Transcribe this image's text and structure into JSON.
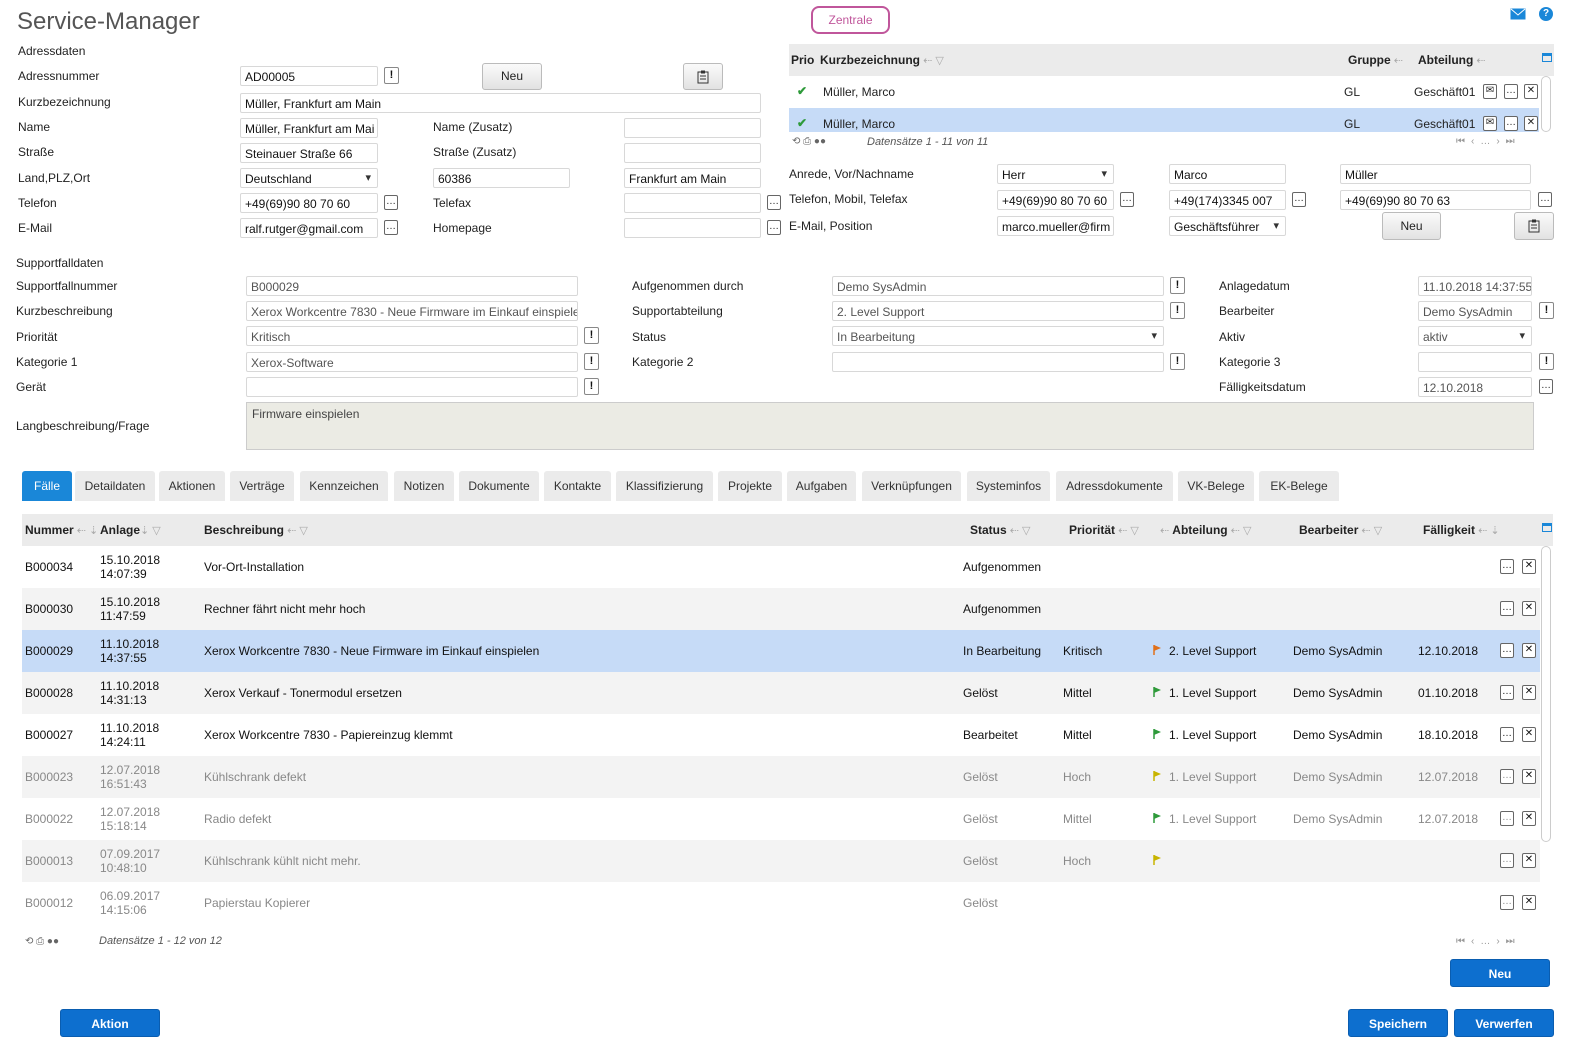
{
  "app": {
    "title": "Service-Manager",
    "zentrale": "Zentrale"
  },
  "adresse": {
    "section": "Adressdaten",
    "labels": {
      "adressnummer": "Adressnummer",
      "kurzbezeichnung": "Kurzbezeichnung",
      "name": "Name",
      "strasse": "Straße",
      "land": "Land,PLZ,Ort",
      "telefon": "Telefon",
      "email": "E-Mail",
      "name_zusatz": "Name (Zusatz)",
      "strasse_zusatz": "Straße (Zusatz)",
      "telefax": "Telefax",
      "homepage": "Homepage"
    },
    "values": {
      "adressnummer": "AD00005",
      "kurzbezeichnung": "Müller, Frankfurt am Main",
      "name": "Müller, Frankfurt am Mai",
      "strasse": "Steinauer Straße 66",
      "land": "Deutschland",
      "plz": "60386",
      "ort": "Frankfurt am Main",
      "telefon": "+49(69)90 80 70 60",
      "email": "ralf.rutger@gmail.com",
      "name_zusatz": "",
      "strasse_zusatz": "",
      "telefax": "",
      "homepage": ""
    },
    "neu_button": "Neu"
  },
  "kontakte": {
    "headers": {
      "prio": "Prio",
      "kurzbezeichnung": "Kurzbezeichnung",
      "gruppe": "Gruppe",
      "abteilung": "Abteilung"
    },
    "rows": [
      {
        "name": "Müller, Marco",
        "gruppe": "GL",
        "abteilung": "Geschäft01"
      },
      {
        "name": "Müller, Marco",
        "gruppe": "GL",
        "abteilung": "Geschäft01"
      }
    ],
    "footer": "Datensätze 1 - 11 von 11",
    "labels": {
      "anrede": "Anrede, Vor/Nachname",
      "telefon": "Telefon, Mobil, Telefax",
      "email": "E-Mail, Position"
    },
    "values": {
      "anrede": "Herr",
      "vorname": "Marco",
      "nachname": "Müller",
      "telefon": "+49(69)90 80 70 60",
      "mobil": "+49(174)3345 007",
      "telefax": "+49(69)90 80 70 63",
      "email": "marco.mueller@firm",
      "position": "Geschäftsführer"
    },
    "neu_button": "Neu"
  },
  "support": {
    "section": "Supportfalldaten",
    "labels": {
      "nummer": "Supportfallnummer",
      "kurz": "Kurzbeschreibung",
      "prio": "Priorität",
      "kat1": "Kategorie 1",
      "geraet": "Gerät",
      "lang": "Langbeschreibung/Frage",
      "aufgenommen": "Aufgenommen durch",
      "abteilung": "Supportabteilung",
      "status": "Status",
      "kat2": "Kategorie 2",
      "anlage": "Anlagedatum",
      "bearbeiter": "Bearbeiter",
      "aktiv": "Aktiv",
      "kat3": "Kategorie 3",
      "faellig": "Fälligkeitsdatum"
    },
    "values": {
      "nummer": "B000029",
      "kurz": "Xerox Workcentre 7830 - Neue Firmware im Einkauf einspiele",
      "prio": "Kritisch",
      "kat1": "Xerox-Software",
      "geraet": "",
      "lang": "Firmware einspielen",
      "aufgenommen": "Demo SysAdmin",
      "abteilung": "2. Level Support",
      "status": "In Bearbeitung",
      "kat2": "",
      "anlage": "11.10.2018 14:37:55",
      "bearbeiter": "Demo SysAdmin",
      "aktiv": "aktiv",
      "kat3": "",
      "faellig": "12.10.2018"
    }
  },
  "tabs": [
    "Fälle",
    "Detaildaten",
    "Aktionen",
    "Verträge",
    "Kennzeichen",
    "Notizen",
    "Dokumente",
    "Kontakte",
    "Klassifizierung",
    "Projekte",
    "Aufgaben",
    "Verknüpfungen",
    "Systeminfos",
    "Adressdokumente",
    "VK-Belege",
    "EK-Belege"
  ],
  "faelle": {
    "headers": {
      "nummer": "Nummer",
      "anlage": "Anlage",
      "beschreibung": "Beschreibung",
      "status": "Status",
      "prioritaet": "Priorität",
      "abteilung": "Abteilung",
      "bearbeiter": "Bearbeiter",
      "faelligkeit": "Fälligkeit"
    },
    "rows": [
      {
        "nummer": "B000034",
        "datum": "15.10.2018",
        "zeit": "14:07:39",
        "beschreibung": "Vor-Ort-Installation",
        "status": "Aufgenommen",
        "prioritaet": "",
        "abteilung": "",
        "bearbeiter": "",
        "faelligkeit": "",
        "flag": ""
      },
      {
        "nummer": "B000030",
        "datum": "15.10.2018",
        "zeit": "11:47:59",
        "beschreibung": "Rechner fährt nicht mehr hoch",
        "status": "Aufgenommen",
        "prioritaet": "",
        "abteilung": "",
        "bearbeiter": "",
        "faelligkeit": "",
        "flag": ""
      },
      {
        "nummer": "B000029",
        "datum": "11.10.2018",
        "zeit": "14:37:55",
        "beschreibung": "Xerox Workcentre 7830 - Neue Firmware im Einkauf einspielen",
        "status": "In Bearbeitung",
        "prioritaet": "Kritisch",
        "abteilung": "2. Level Support",
        "bearbeiter": "Demo SysAdmin",
        "faelligkeit": "12.10.2018",
        "flag": "#e0701a"
      },
      {
        "nummer": "B000028",
        "datum": "11.10.2018",
        "zeit": "14:31:13",
        "beschreibung": "Xerox Verkauf - Tonermodul ersetzen",
        "status": "Gelöst",
        "prioritaet": "Mittel",
        "abteilung": "1. Level Support",
        "bearbeiter": "Demo SysAdmin",
        "faelligkeit": "01.10.2018",
        "flag": "#2e9a3a"
      },
      {
        "nummer": "B000027",
        "datum": "11.10.2018",
        "zeit": "14:24:11",
        "beschreibung": "Xerox Workcentre 7830 - Papiereinzug klemmt",
        "status": "Bearbeitet",
        "prioritaet": "Mittel",
        "abteilung": "1. Level Support",
        "bearbeiter": "Demo SysAdmin",
        "faelligkeit": "18.10.2018",
        "flag": "#2e9a3a"
      },
      {
        "nummer": "B000023",
        "datum": "12.07.2018",
        "zeit": "16:51:43",
        "beschreibung": "Kühlschrank defekt",
        "status": "Gelöst",
        "prioritaet": "Hoch",
        "abteilung": "1. Level Support",
        "bearbeiter": "Demo SysAdmin",
        "faelligkeit": "12.07.2018",
        "flag": "#c8b400"
      },
      {
        "nummer": "B000022",
        "datum": "12.07.2018",
        "zeit": "15:18:14",
        "beschreibung": "Radio defekt",
        "status": "Gelöst",
        "prioritaet": "Mittel",
        "abteilung": "1. Level Support",
        "bearbeiter": "Demo SysAdmin",
        "faelligkeit": "12.07.2018",
        "flag": "#2e9a3a"
      },
      {
        "nummer": "B000013",
        "datum": "07.09.2017",
        "zeit": "10:48:10",
        "beschreibung": "Kühlschrank kühlt nicht mehr.",
        "status": "Gelöst",
        "prioritaet": "Hoch",
        "abteilung": "",
        "bearbeiter": "",
        "faelligkeit": "",
        "flag": "#c8b400"
      },
      {
        "nummer": "B000012",
        "datum": "06.09.2017",
        "zeit": "14:15:06",
        "beschreibung": "Papierstau Kopierer",
        "status": "Gelöst",
        "prioritaet": "",
        "abteilung": "",
        "bearbeiter": "",
        "faelligkeit": "",
        "flag": ""
      }
    ],
    "footer": "Datensätze 1 - 12 von 12",
    "neu_button": "Neu"
  },
  "actions": {
    "aktion": "Aktion",
    "speichern": "Speichern",
    "verwerfen": "Verwerfen"
  }
}
